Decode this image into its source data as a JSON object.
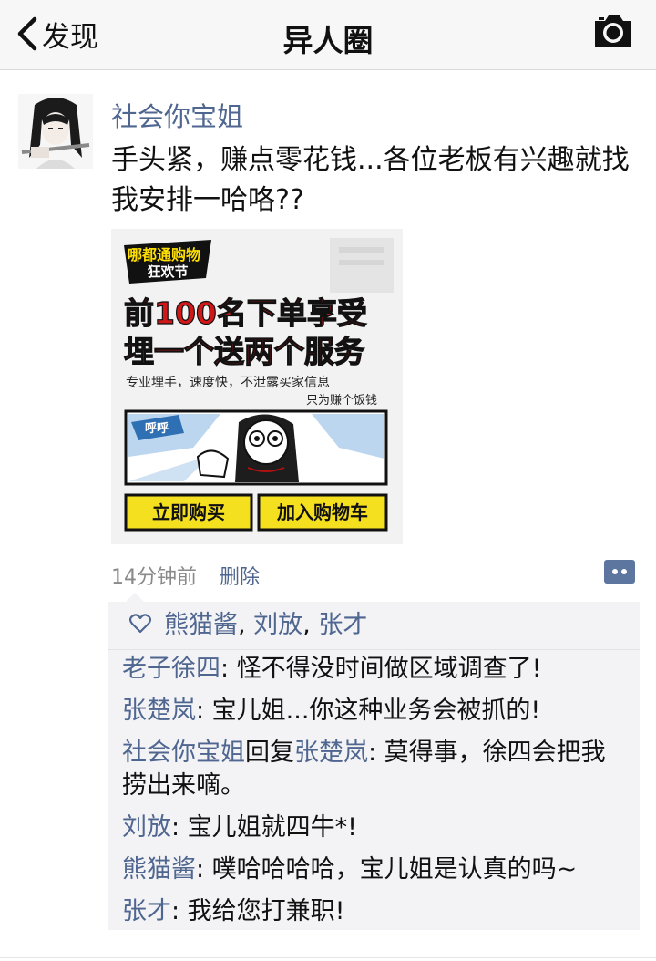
{
  "nav": {
    "back_label": "发现",
    "title": "异人圈"
  },
  "post": {
    "author": "社会你宝姐",
    "text": "手头紧，赚点零花钱...各位老板有兴趣就找我安排一哈咯??",
    "time": "14分钟前",
    "delete_label": "删除",
    "image": {
      "badge_line1": "哪都通购物",
      "badge_line2": "狂欢节",
      "headline_line1": "前100名下单享受",
      "headline_line2": "埋一个送两个服务",
      "subtext": "专业埋手，速度快，不泄露买家信息",
      "subtext2": "只为赚个饭钱",
      "bubble": "呼呼",
      "buy_now": "立即购买",
      "add_cart": "加入购物车"
    }
  },
  "likes": [
    "熊猫酱",
    "刘放",
    "张才"
  ],
  "comments": [
    {
      "name": "老子徐四",
      "text": ": 怪不得没时间做区域调查了!"
    },
    {
      "name": "张楚岚",
      "text": ": 宝儿姐...你这种业务会被抓的!"
    },
    {
      "name": "社会你宝姐",
      "reply_word": "回复",
      "reply_to": "张楚岚",
      "text": ": 莫得事，徐四会把我捞出来嘀。"
    },
    {
      "name": "刘放",
      "text": ": 宝儿姐就四牛*!"
    },
    {
      "name": "熊猫酱",
      "text": ": 噗哈哈哈哈，宝儿姐是认真的吗~"
    },
    {
      "name": "张才",
      "text": ": 我给您打兼职!"
    }
  ],
  "colors": {
    "link_blue": "#4f6690",
    "headline_red": "#d01818",
    "button_yellow": "#f5e020"
  },
  "icons": [
    "chevron-left-icon",
    "camera-icon",
    "heart-icon",
    "more-dots-icon"
  ]
}
